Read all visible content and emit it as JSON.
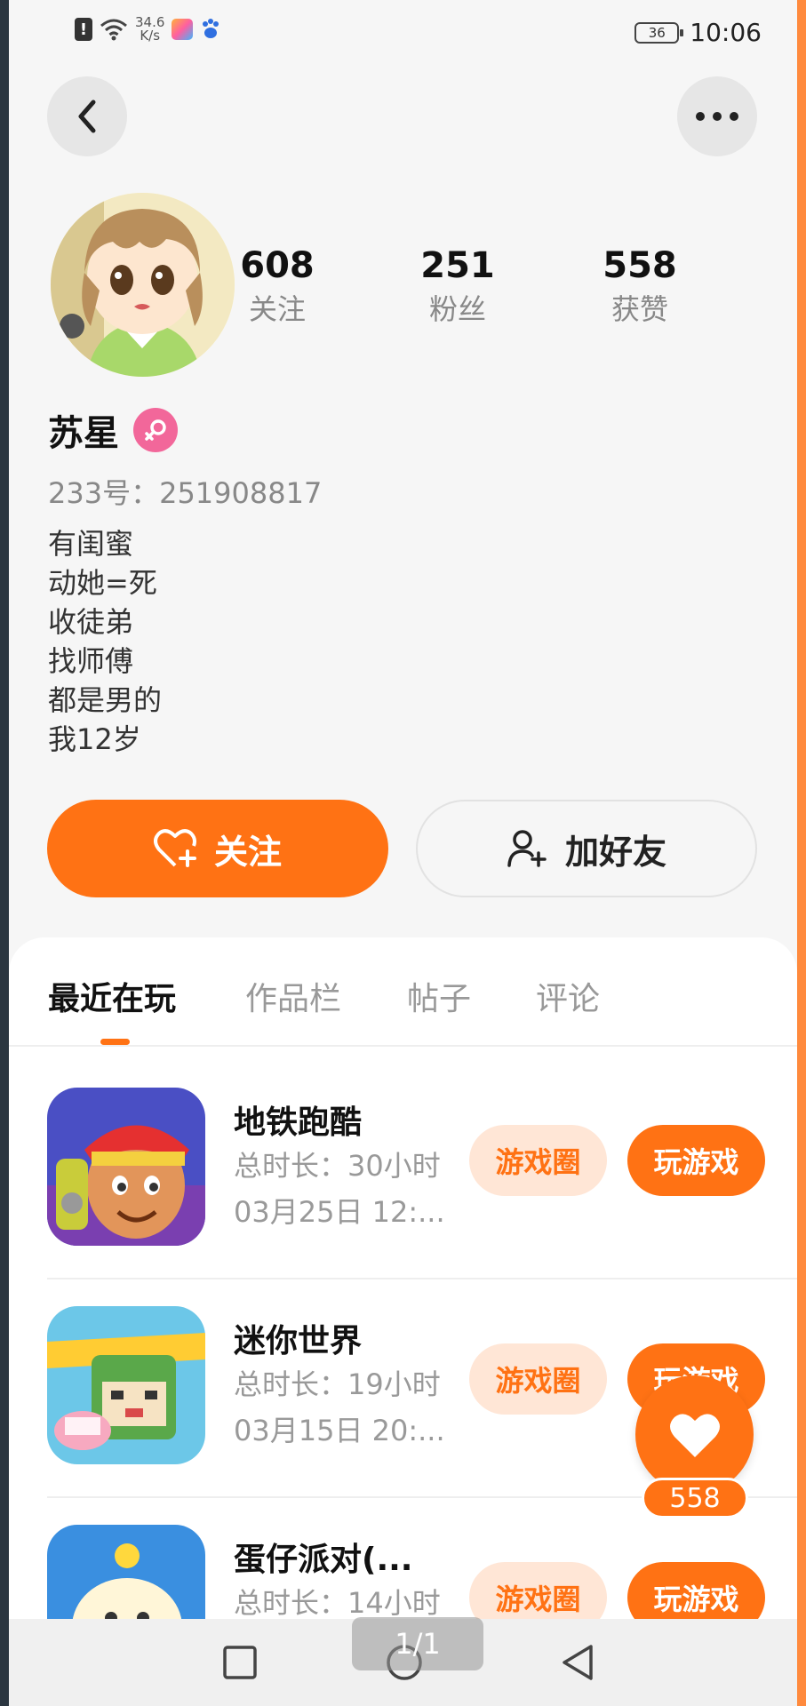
{
  "status_bar": {
    "alert_glyph": "!",
    "net_speed_value": "34.6",
    "net_speed_unit": "K/s",
    "battery": "36",
    "time": "10:06"
  },
  "header": {
    "back_icon": "chevron-left-icon",
    "more_icon": "more-horizontal-icon"
  },
  "profile": {
    "stats": [
      {
        "value": "608",
        "label": "关注"
      },
      {
        "value": "251",
        "label": "粉丝"
      },
      {
        "value": "558",
        "label": "获赞"
      }
    ],
    "name": "苏星",
    "gender_icon": "female-icon",
    "gender_color": "#f2679a",
    "account_id": "233号：251908817",
    "bio": [
      "有闺蜜",
      "动她=死",
      "收徒弟",
      "找师傅",
      "都是男的",
      "我12岁"
    ]
  },
  "actions": {
    "follow_label": "关注",
    "add_friend_label": "加好友"
  },
  "tabs": [
    {
      "label": "最近在玩",
      "active": true
    },
    {
      "label": "作品栏",
      "active": false
    },
    {
      "label": "帖子",
      "active": false
    },
    {
      "label": "评论",
      "active": false
    }
  ],
  "games": [
    {
      "title": "地铁跑酷",
      "total_time": "总时长：30小时",
      "last_played": "03月25日 12:...",
      "circle_label": "游戏圈",
      "play_label": "玩游戏"
    },
    {
      "title": "迷你世界",
      "total_time": "总时长：19小时",
      "last_played": "03月15日 20:...",
      "circle_label": "游戏圈",
      "play_label": "玩游戏"
    },
    {
      "title": "蛋仔派对(...",
      "total_time": "总时长：14小时",
      "last_played": "",
      "circle_label": "游戏圈",
      "play_label": "玩游戏"
    }
  ],
  "floating_like": {
    "count": "558"
  },
  "page_indicator": "1/1",
  "colors": {
    "accent": "#ff7214",
    "accent_light": "#ffe6d6",
    "background": "#f6f6f6"
  }
}
